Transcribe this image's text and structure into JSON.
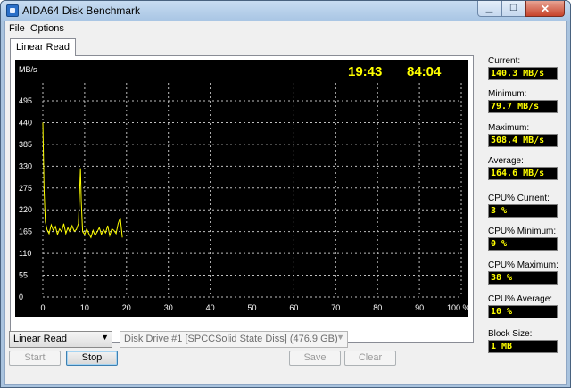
{
  "window": {
    "title": "AIDA64 Disk Benchmark"
  },
  "menu": [
    {
      "label": "File"
    },
    {
      "label": "Options"
    }
  ],
  "tab": {
    "label": "Linear Read"
  },
  "chart": {
    "time_elapsed": "19:43",
    "time_remaining": "84:04",
    "y_unit": "MB/s",
    "line_color": "#ffff00",
    "grid_color": "#c0c0c0"
  },
  "chart_data": {
    "type": "line",
    "xlim": [
      0,
      100
    ],
    "ylim": [
      0,
      540
    ],
    "y_ticks": [
      "495",
      "440",
      "385",
      "330",
      "275",
      "220",
      "165",
      "110",
      "55",
      "0"
    ],
    "x_ticks": [
      "0",
      "10",
      "20",
      "30",
      "40",
      "50",
      "60",
      "70",
      "80",
      "90",
      "100 %"
    ],
    "series": [
      {
        "x": [
          0,
          0.3,
          0.6,
          1,
          1.5,
          2,
          2.5,
          3,
          3.5,
          4,
          4.5,
          5,
          5.5,
          6,
          6.5,
          7,
          7.5,
          8,
          8.5,
          9,
          9.2,
          9.5,
          10,
          10.5,
          11,
          11.5,
          12,
          12.5,
          13,
          13.5,
          14,
          14.5,
          15,
          15.5,
          16,
          16.5,
          17,
          17.5,
          18,
          18.5,
          19
        ],
        "y": [
          440,
          270,
          190,
          170,
          160,
          182,
          168,
          178,
          158,
          172,
          165,
          185,
          160,
          175,
          163,
          180,
          166,
          170,
          185,
          325,
          240,
          165,
          158,
          172,
          160,
          150,
          168,
          155,
          165,
          175,
          158,
          170,
          162,
          180,
          155,
          172,
          168,
          160,
          185,
          200,
          150
        ]
      }
    ]
  },
  "stats": [
    {
      "label": "Current:",
      "value": "140.3 MB/s"
    },
    {
      "label": "Minimum:",
      "value": "79.7 MB/s"
    },
    {
      "label": "Maximum:",
      "value": "508.4 MB/s"
    },
    {
      "label": "Average:",
      "value": "164.6 MB/s"
    },
    {
      "label": "CPU% Current:",
      "value": "3 %"
    },
    {
      "label": "CPU% Minimum:",
      "value": "0 %"
    },
    {
      "label": "CPU% Maximum:",
      "value": "38 %"
    },
    {
      "label": "CPU% Average:",
      "value": "10 %"
    },
    {
      "label": "Block Size:",
      "value": "1 MB"
    }
  ],
  "controls": {
    "test_select": "Linear Read",
    "drive_select": "Disk Drive #1  [SPCCSolid State Diss]  (476.9 GB)",
    "start_label": "Start",
    "stop_label": "Stop",
    "save_label": "Save",
    "clear_label": "Clear"
  }
}
